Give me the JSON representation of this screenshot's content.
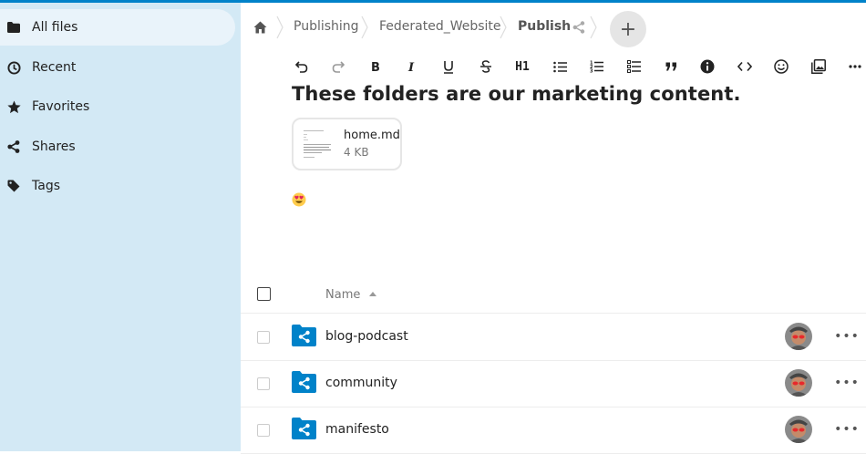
{
  "sidebar": {
    "items": [
      {
        "label": "All files",
        "icon": "folder-icon",
        "active": true
      },
      {
        "label": "Recent",
        "icon": "clock-icon"
      },
      {
        "label": "Favorites",
        "icon": "star-icon"
      },
      {
        "label": "Shares",
        "icon": "share-icon"
      },
      {
        "label": "Tags",
        "icon": "tag-icon"
      }
    ]
  },
  "breadcrumb": {
    "items": [
      "Publishing",
      "Federated_Website",
      "Publish"
    ],
    "add_label": "+"
  },
  "toolbar": {
    "buttons": [
      "undo-icon",
      "redo-icon",
      "bold-icon",
      "italic-icon",
      "underline-icon",
      "strikethrough-icon",
      "heading-icon",
      "bullet-list-icon",
      "ordered-list-icon",
      "checklist-icon",
      "blockquote-icon",
      "info-icon",
      "code-icon",
      "emoji-icon",
      "image-icon",
      "more-icon"
    ],
    "heading_label": "H1"
  },
  "workspace": {
    "title": "These folders are our marketing content.",
    "attachment": {
      "name": "home.md",
      "size": "4 KB"
    }
  },
  "file_list": {
    "name_header": "Name",
    "rows": [
      {
        "name": "blog-podcast"
      },
      {
        "name": "community"
      },
      {
        "name": "manifesto"
      }
    ],
    "more_label": "•••"
  },
  "colors": {
    "accent": "#0082c9",
    "sidebar_bg": "#d3e9f5",
    "folder": "#0082c9"
  }
}
